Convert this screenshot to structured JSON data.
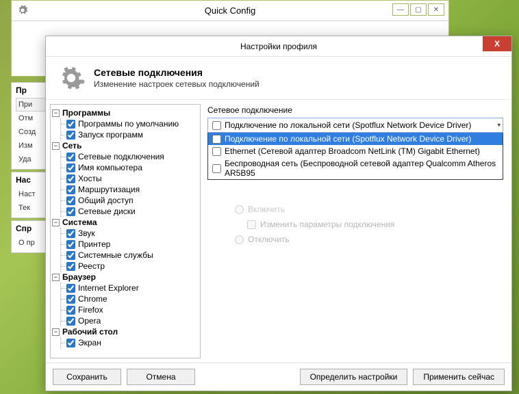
{
  "parent_window": {
    "title": "Quick Config"
  },
  "left_backtabs": {
    "groups": [
      {
        "header": "Пр",
        "items": [
          {
            "label": "При",
            "active": true
          },
          {
            "label": "Отм"
          },
          {
            "label": "Созд"
          },
          {
            "label": "Изм"
          },
          {
            "label": "Уда"
          }
        ]
      },
      {
        "header": "Нас",
        "items": [
          {
            "label": "Наст"
          },
          {
            "label": "Тек"
          }
        ]
      },
      {
        "header": "Спр",
        "items": [
          {
            "label": "О пр"
          }
        ]
      }
    ]
  },
  "dialog": {
    "title": "Настройки профиля",
    "section_title": "Сетевые подключения",
    "section_subtitle": "Изменение настроек сетевых подключений"
  },
  "tree": [
    {
      "label": "Программы",
      "children": [
        {
          "label": "Программы по умолчанию",
          "checked": true
        },
        {
          "label": "Запуск программ",
          "checked": true
        }
      ]
    },
    {
      "label": "Сеть",
      "children": [
        {
          "label": "Сетевые подключения",
          "checked": true
        },
        {
          "label": "Имя компьютера",
          "checked": true
        },
        {
          "label": "Хосты",
          "checked": true
        },
        {
          "label": "Маршрутизация",
          "checked": true
        },
        {
          "label": "Общий доступ",
          "checked": true
        },
        {
          "label": "Сетевые диски",
          "checked": true
        }
      ]
    },
    {
      "label": "Система",
      "children": [
        {
          "label": "Звук",
          "checked": true
        },
        {
          "label": "Принтер",
          "checked": true
        },
        {
          "label": "Системные службы",
          "checked": true
        },
        {
          "label": "Реестр",
          "checked": true
        }
      ]
    },
    {
      "label": "Браузер",
      "children": [
        {
          "label": "Internet Explorer",
          "checked": true
        },
        {
          "label": "Chrome",
          "checked": true
        },
        {
          "label": "Firefox",
          "checked": true
        },
        {
          "label": "Opera",
          "checked": true
        }
      ]
    },
    {
      "label": "Рабочий стол",
      "children": [
        {
          "label": "Экран",
          "checked": true
        }
      ]
    }
  ],
  "right": {
    "label": "Сетевое подключение",
    "selected": "Подключение по локальной сети (Spotflux Network Device Driver)",
    "options": [
      "Подключение по локальной сети (Spotflux Network Device Driver)",
      "Ethernet (Сетевой адаптер Broadcom NetLink (TM) Gigabit Ethernet)",
      "Беспроводная сеть (Беспроводной сетевой адаптер Qualcomm Atheros AR5B95"
    ],
    "radio_enable": "Включить",
    "checkbox_modify": "Изменить параметры подключения",
    "radio_disable": "Отключить"
  },
  "buttons": {
    "save": "Сохранить",
    "cancel": "Отмена",
    "detect": "Определить настройки",
    "apply": "Применить сейчас"
  }
}
